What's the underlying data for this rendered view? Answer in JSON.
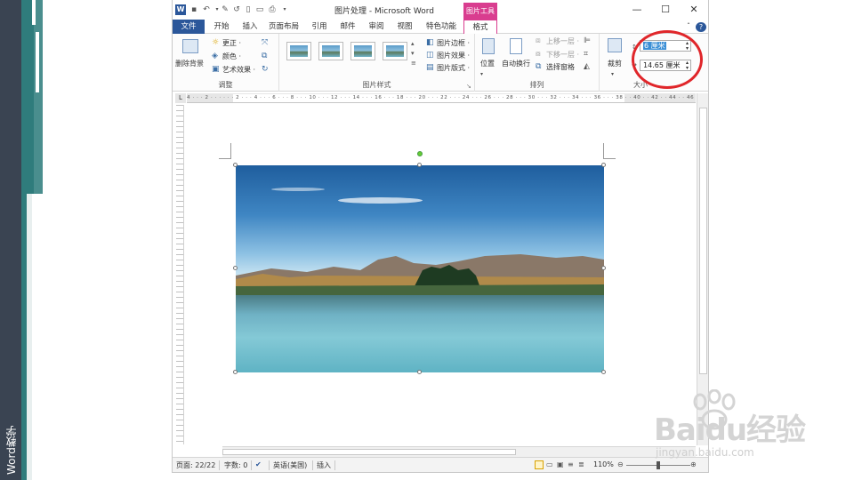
{
  "side_label": "Word教学",
  "titlebar": {
    "app_icon": "W",
    "title": "图片处理 - Microsoft Word",
    "context_header": "图片工具",
    "minimize": "—",
    "maximize": "☐",
    "close": "✕"
  },
  "tabs": [
    "文件",
    "开始",
    "插入",
    "页面布局",
    "引用",
    "邮件",
    "审阅",
    "视图",
    "特色功能",
    "格式"
  ],
  "ribbon": {
    "adjust": {
      "remove_bg": "删除背景",
      "corrections": "更正 ·",
      "color": "颜色 ·",
      "artistic": "艺术效果 ·",
      "label": "调整"
    },
    "styles": {
      "border": "图片边框 ·",
      "effects": "图片效果 ·",
      "layout": "图片版式 ·",
      "label": "图片样式"
    },
    "arrange": {
      "position": "位置",
      "wrap": "自动换行",
      "bring_forward": "上移一层 ·",
      "send_backward": "下移一层 ·",
      "selection_pane": "选择窗格",
      "label": "排列"
    },
    "size": {
      "crop": "裁剪",
      "height": "6 厘米",
      "width": "14.65 厘米",
      "label": "大小"
    }
  },
  "ruler_ticks": "4 · · · 2 · · · · · · 2 · · · 4 · · · 6 · · · 8 · · · 10 · · · 12 · · · 14 · · · 16 · · · 18 · · · 20 · · · 22 · · · 24 · · · 26 · · · 28 · · · 30 · · · 32 · · · 34 · · · 36 · · · 38 · · 40 · · 42 · · 44 · · 46 · · 48",
  "status": {
    "page": "页面: 22/22",
    "words": "字数: 0",
    "language": "英语(美国)",
    "mode": "插入",
    "zoom": "110%"
  },
  "watermark": {
    "brand": "Baidu经验",
    "url": "jingyan.baidu.com"
  },
  "colors": {
    "word_blue": "#2b579a",
    "picture_tools": "#d93d8f",
    "annotation_red": "#e0262a"
  }
}
